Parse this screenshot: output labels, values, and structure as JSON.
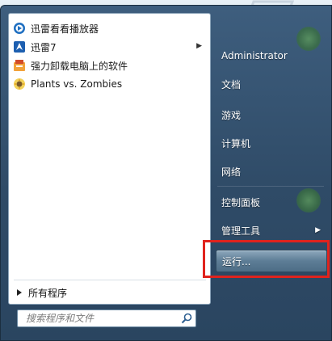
{
  "programs": [
    {
      "label": "迅雷看看播放器",
      "icon": "xunlei-player-icon",
      "has_submenu": false
    },
    {
      "label": "迅雷7",
      "icon": "xunlei7-icon",
      "has_submenu": true
    },
    {
      "label": "强力卸载电脑上的软件",
      "icon": "uninstaller-icon",
      "has_submenu": false
    },
    {
      "label": "Plants vs. Zombies",
      "icon": "plants-vs-zombies-icon",
      "has_submenu": false
    }
  ],
  "all_programs_label": "所有程序",
  "search": {
    "placeholder": "搜索程序和文件"
  },
  "right_items": [
    {
      "label": "Administrator",
      "has_submenu": false
    },
    {
      "label": "文档",
      "has_submenu": false
    },
    {
      "label": "游戏",
      "has_submenu": false
    },
    {
      "label": "计算机",
      "has_submenu": false
    },
    {
      "label": "网络",
      "has_submenu": false
    },
    {
      "label": "控制面板",
      "has_submenu": false
    },
    {
      "label": "管理工具",
      "has_submenu": true
    },
    {
      "label": "运行...",
      "has_submenu": false
    }
  ],
  "colors": {
    "highlight_border": "#e0231d",
    "menu_panel": "#2f4b67"
  }
}
